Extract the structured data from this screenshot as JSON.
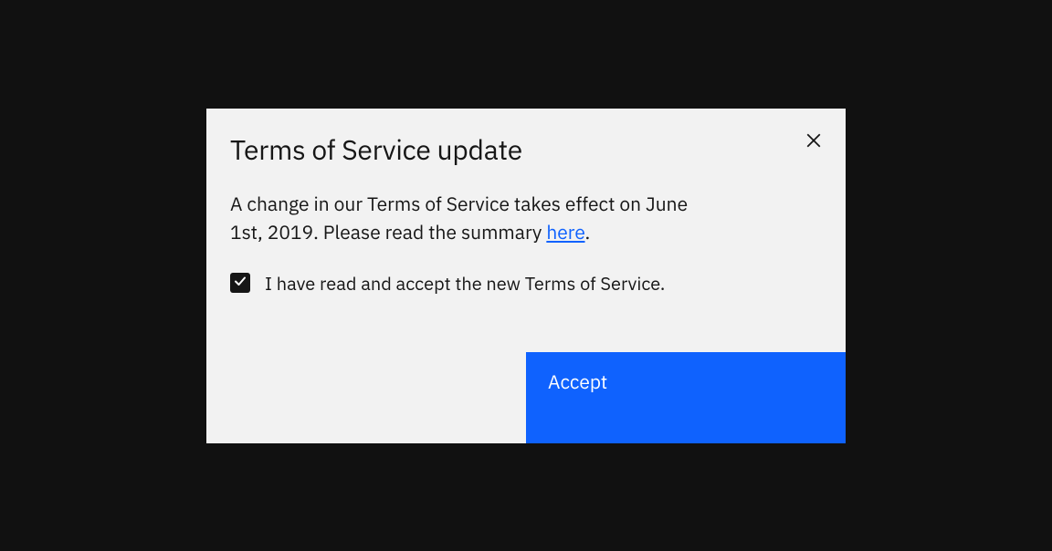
{
  "modal": {
    "title": "Terms of Service update",
    "body_prefix": "A change in our Terms of Service takes effect on June 1st, 2019. Please read the summary ",
    "body_link_text": "here",
    "body_suffix": ".",
    "checkbox": {
      "checked": true,
      "label": "I have read and accept the new Terms of Service."
    },
    "accept_label": "Accept"
  }
}
